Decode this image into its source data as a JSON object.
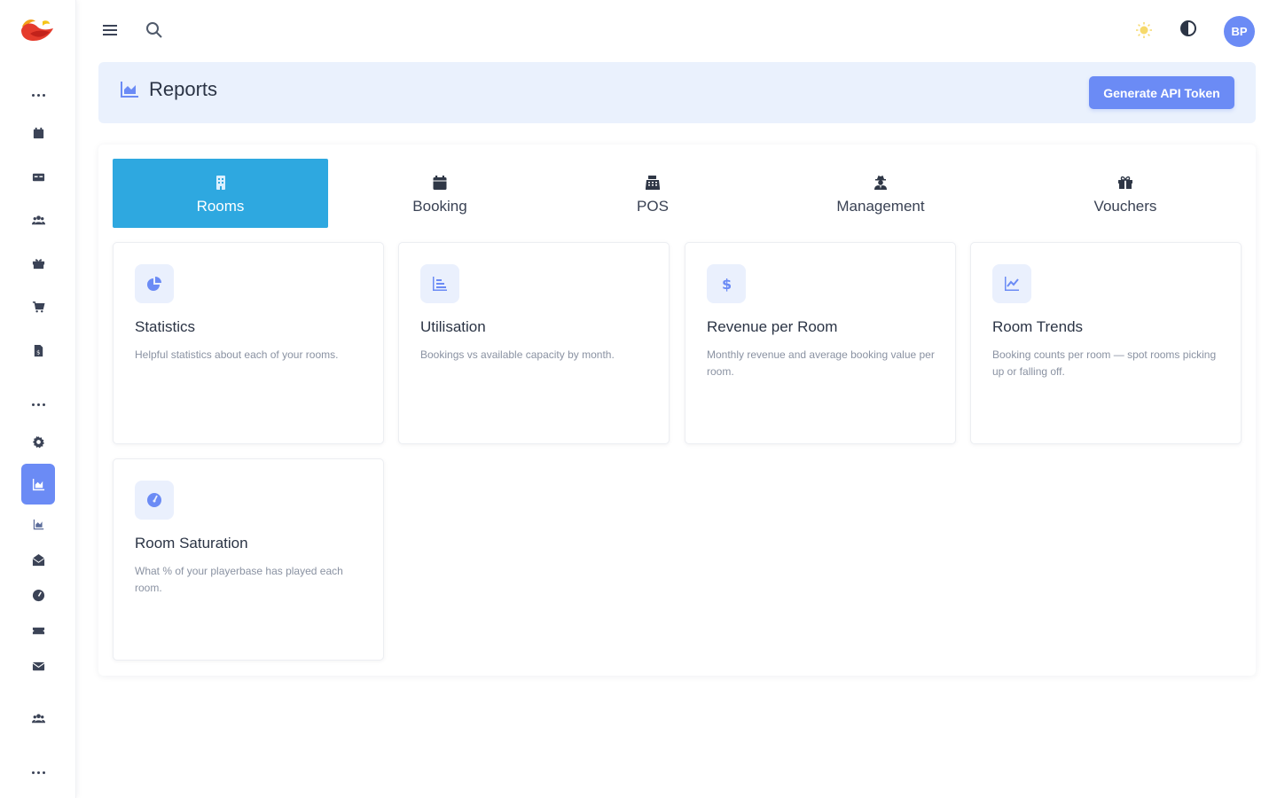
{
  "app": {
    "avatar_initials": "BP",
    "accent_color": "#6b8bf5",
    "active_tab_color": "#2ea8e0"
  },
  "topbar": {
    "menu_icon": "hamburger-icon",
    "search_icon": "search-icon",
    "theme_icon": "sun-icon",
    "contrast_icon": "contrast-icon"
  },
  "sidebar": {
    "items": [
      {
        "icon": "calendar-icon"
      },
      {
        "icon": "id-card-icon"
      },
      {
        "icon": "users-icon"
      },
      {
        "icon": "gift-icon"
      },
      {
        "icon": "cart-icon"
      },
      {
        "icon": "invoice-icon"
      },
      {
        "icon": "gear-icon"
      },
      {
        "icon": "area-chart-icon",
        "active": true
      },
      {
        "icon": "area-chart-small-icon"
      },
      {
        "icon": "envelope-open-icon"
      },
      {
        "icon": "gauge-icon"
      },
      {
        "icon": "ticket-icon"
      },
      {
        "icon": "envelope-icon"
      },
      {
        "icon": "users-group-icon"
      }
    ]
  },
  "header": {
    "title": "Reports",
    "api_button": "Generate API Token"
  },
  "tabs": [
    {
      "label": "Rooms",
      "icon": "building-icon",
      "active": true
    },
    {
      "label": "Booking",
      "icon": "calendar-icon"
    },
    {
      "label": "POS",
      "icon": "cash-register-icon"
    },
    {
      "label": "Management",
      "icon": "user-secret-icon"
    },
    {
      "label": "Vouchers",
      "icon": "gift-icon"
    }
  ],
  "cards": [
    {
      "title": "Statistics",
      "description": "Helpful statistics about each of your rooms.",
      "icon": "pie-chart-icon"
    },
    {
      "title": "Utilisation",
      "description": "Bookings vs available capacity by month.",
      "icon": "bar-chart-icon"
    },
    {
      "title": "Revenue per Room",
      "description": "Monthly revenue and average booking value per room.",
      "icon": "dollar-icon"
    },
    {
      "title": "Room Trends",
      "description": "Booking counts per room — spot rooms picking up or falling off.",
      "icon": "line-chart-icon"
    },
    {
      "title": "Room Saturation",
      "description": "What % of your playerbase has played each room.",
      "icon": "gauge-icon"
    }
  ]
}
